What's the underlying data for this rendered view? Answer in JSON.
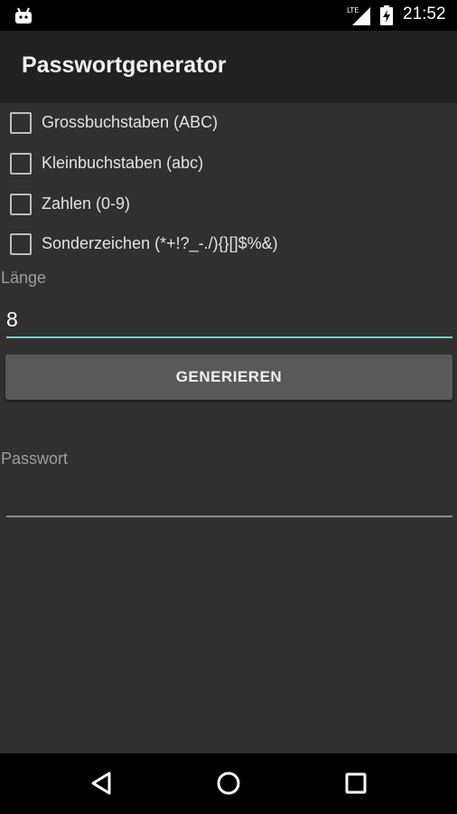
{
  "status_bar": {
    "time": "21:52",
    "network_label": "LTE",
    "icons": [
      "android-icon",
      "lte-signal-icon",
      "battery-charging-icon"
    ]
  },
  "app_bar": {
    "title": "Passwortgenerator"
  },
  "options": [
    {
      "label": "Grossbuchstaben (ABC)",
      "checked": false
    },
    {
      "label": "Kleinbuchstaben (abc)",
      "checked": false
    },
    {
      "label": "Zahlen (0-9)",
      "checked": false
    },
    {
      "label": "Sonderzeichen (*+!?_-./){}[]$%&)",
      "checked": false
    }
  ],
  "length": {
    "label": "Länge",
    "value": "8"
  },
  "generate_button": {
    "label": "GENERIEREN"
  },
  "password": {
    "label": "Passwort",
    "value": ""
  },
  "nav_bar": {
    "icons": [
      "back-icon",
      "home-icon",
      "recents-icon"
    ]
  },
  "colors": {
    "background": "#303030",
    "app_bar": "#212121",
    "accent": "#80cbc4",
    "button": "#595959"
  }
}
